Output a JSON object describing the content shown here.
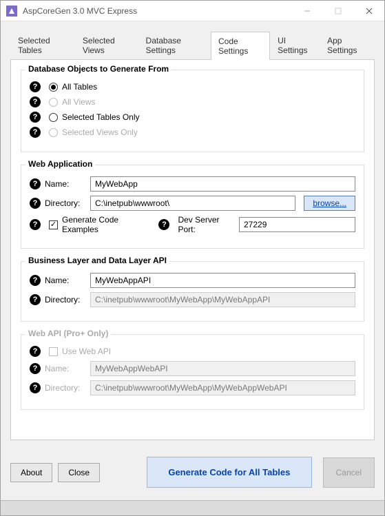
{
  "window": {
    "title": "AspCoreGen 3.0 MVC Express"
  },
  "tabs": [
    {
      "label": "Selected Tables"
    },
    {
      "label": "Selected Views"
    },
    {
      "label": "Database Settings"
    },
    {
      "label": "Code Settings"
    },
    {
      "label": "UI Settings"
    },
    {
      "label": "App Settings"
    }
  ],
  "dbObjects": {
    "title": "Database Objects to Generate From",
    "options": {
      "allTables": "All Tables",
      "allViews": "All Views",
      "selectedTables": "Selected Tables Only",
      "selectedViews": "Selected Views Only"
    }
  },
  "webApp": {
    "title": "Web Application",
    "nameLabel": "Name:",
    "nameValue": "MyWebApp",
    "dirLabel": "Directory:",
    "dirValue": "C:\\inetpub\\wwwroot\\",
    "browse": "browse...",
    "genExamples": "Generate Code Examples",
    "portLabel": "Dev Server Port:",
    "portValue": "27229"
  },
  "bizLayer": {
    "title": "Business Layer and Data Layer API",
    "nameLabel": "Name:",
    "nameValue": "MyWebAppAPI",
    "dirLabel": "Directory:",
    "dirValue": "C:\\inetpub\\wwwroot\\MyWebApp\\MyWebAppAPI"
  },
  "webApi": {
    "title": "Web API (Pro+ Only)",
    "useLabel": "Use Web API",
    "nameLabel": "Name:",
    "nameValue": "MyWebAppWebAPI",
    "dirLabel": "Directory:",
    "dirValue": "C:\\inetpub\\wwwroot\\MyWebApp\\MyWebAppWebAPI"
  },
  "footer": {
    "about": "About",
    "close": "Close",
    "generate": "Generate Code for All Tables",
    "cancel": "Cancel"
  }
}
